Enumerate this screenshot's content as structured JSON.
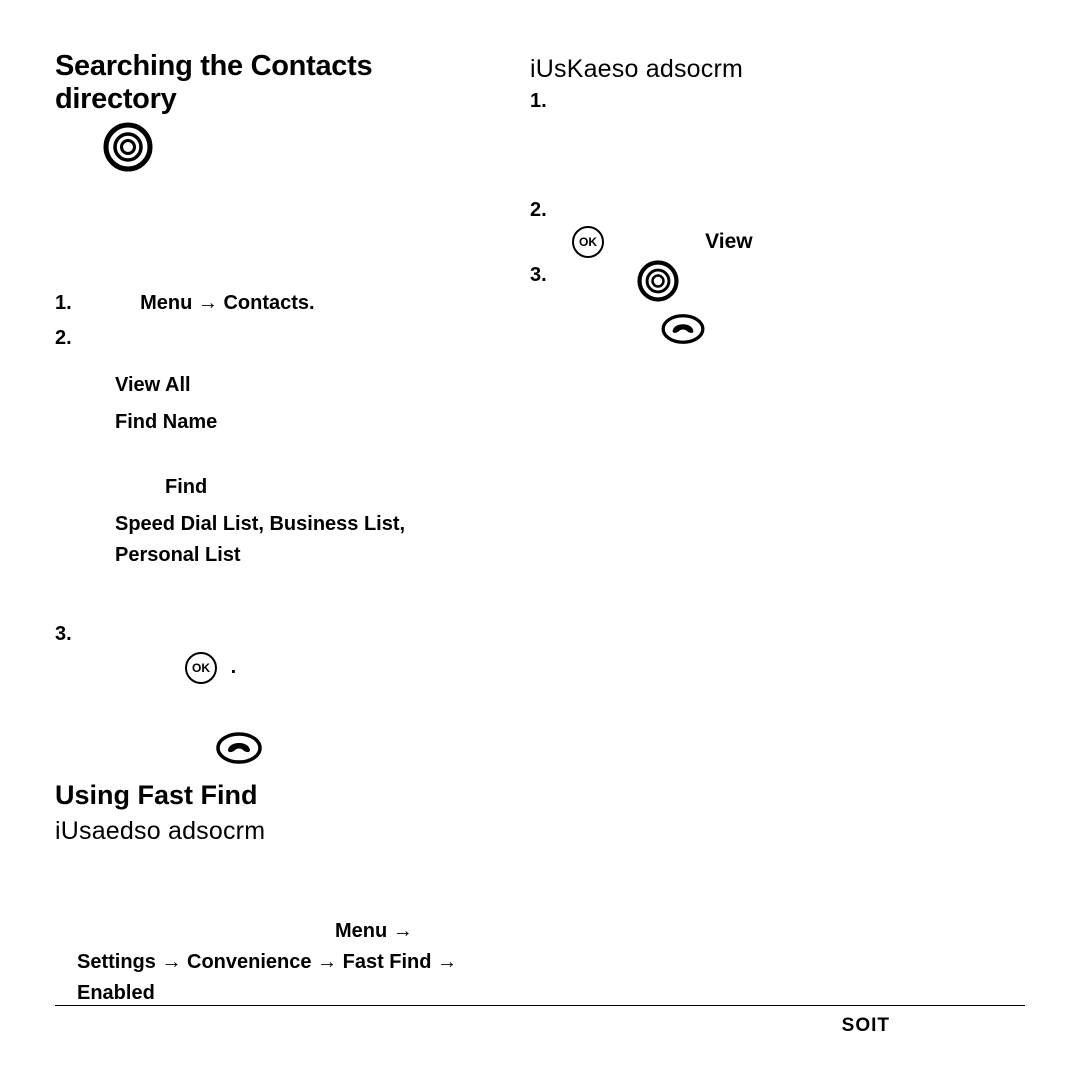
{
  "left": {
    "h1": "Searching the Contacts directory",
    "step1_num": "1.",
    "step1_label": "Menu → Contacts.",
    "step2_num": "2.",
    "viewall": "View All",
    "findname": "Find Name",
    "find": "Find",
    "lists": "Speed Dial List, Business List,",
    "personal": "Personal List",
    "step3_num": "3.",
    "dot": ".",
    "h2": "Using Fast Find",
    "sub2": "iUsaedso adsocrm",
    "menu_arrow": "Menu →",
    "settings_line": "Settings → Convenience → Fast Find →",
    "enabled": "Enabled"
  },
  "right": {
    "sub": "iUsKaeso adsocrm",
    "n1": "1.",
    "n2": "2.",
    "view": "View",
    "n3": "3."
  },
  "footer": "SOIT",
  "ok_label": "OK"
}
